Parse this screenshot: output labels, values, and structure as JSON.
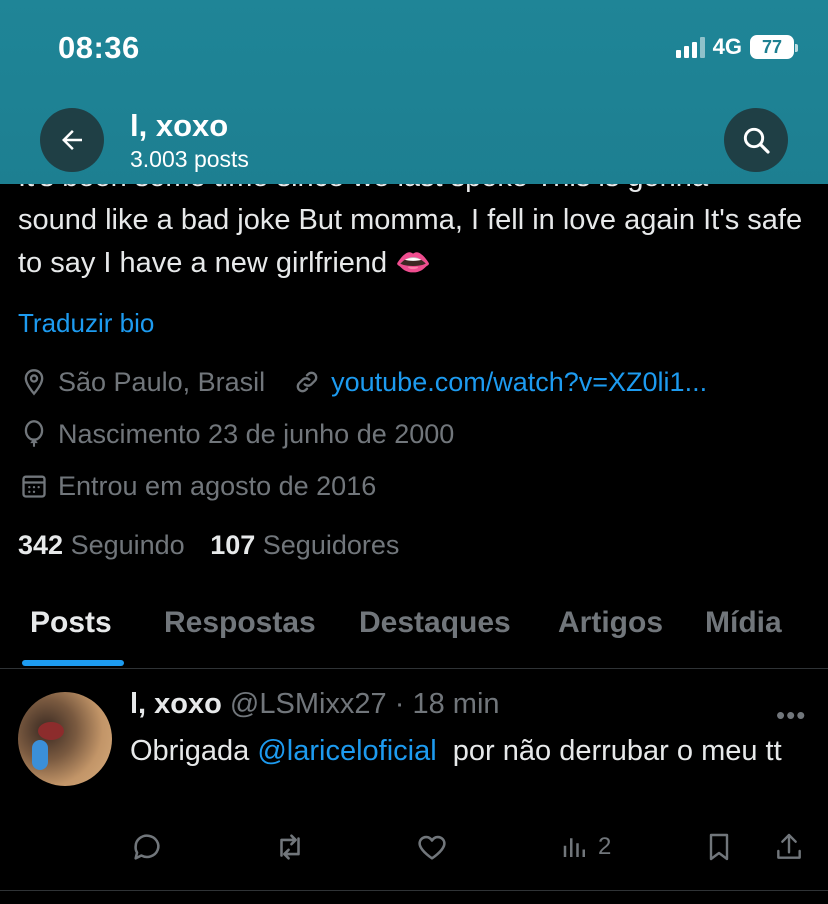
{
  "status": {
    "time": "08:36",
    "network": "4G",
    "battery": "77"
  },
  "header": {
    "title": "l, xoxo",
    "posts": "3.003 posts"
  },
  "bio": {
    "partial_line": "It's been some time since we last spoke This is gonna",
    "text": "sound like a bad joke But momma, I fell in love again It's safe to say I have a new girlfriend",
    "emoji": "👄",
    "translate": "Traduzir bio"
  },
  "meta": {
    "location": "São Paulo, Brasil",
    "link": "youtube.com/watch?v=XZ0li1...",
    "birth": "Nascimento 23 de junho de 2000",
    "joined": "Entrou em agosto de 2016"
  },
  "follow": {
    "following_count": "342",
    "following_label": "Seguindo",
    "followers_count": "107",
    "followers_label": "Seguidores"
  },
  "tabs": [
    "Posts",
    "Respostas",
    "Destaques",
    "Artigos",
    "Mídia"
  ],
  "tweet": {
    "name": "l, xoxo",
    "handle": "@LSMixx27",
    "time": "· 18 min",
    "text_before": "Obrigada ",
    "mention": "@lariceloficial",
    "text_after": "  por não derrubar o meu tt",
    "views": "2"
  },
  "colors": {
    "header": "#1d7f91",
    "accent": "#1d9bf0",
    "muted": "#71767b"
  }
}
